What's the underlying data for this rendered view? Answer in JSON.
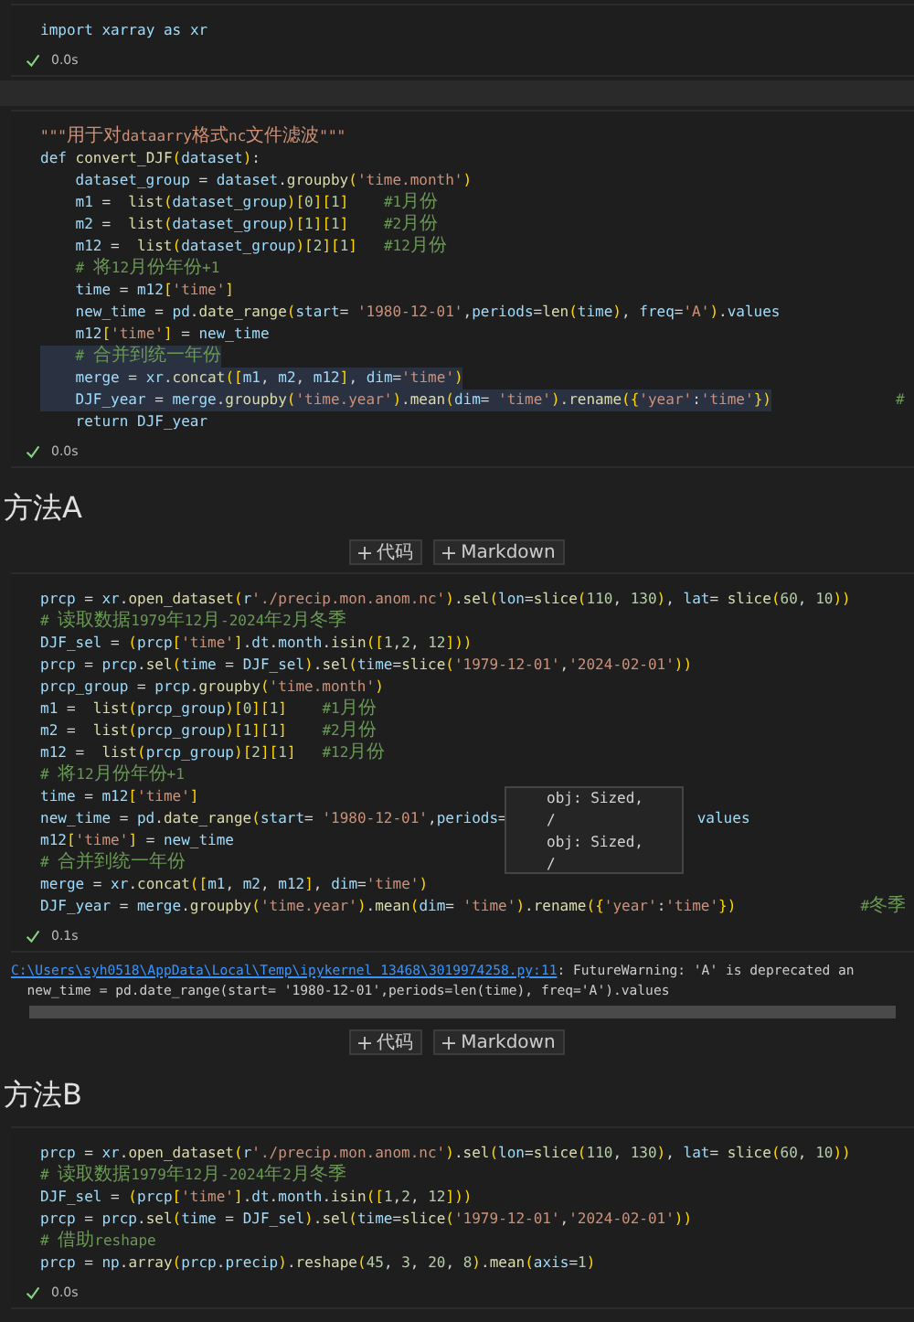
{
  "items": [
    {
      "kind": "code",
      "lines": [
        {
          "text": "import xarray as xr"
        }
      ],
      "status": {
        "time": "0.0s"
      }
    },
    {
      "kind": "gap"
    },
    {
      "kind": "code",
      "lines": [
        {
          "text": "\"\"\"用于对dataarry格式nc文件滤波\"\"\"",
          "selected": false
        },
        {
          "text": "def convert_DJF(dataset):",
          "selected": false
        },
        {
          "text": "    dataset_group = dataset.groupby('time.month')",
          "selected": false
        },
        {
          "text": "    m1 =  list(dataset_group)[0][1]    #1月份",
          "selected": false
        },
        {
          "text": "    m2 =  list(dataset_group)[1][1]    #2月份",
          "selected": false
        },
        {
          "text": "    m12 =  list(dataset_group)[2][1]   #12月份",
          "selected": false
        },
        {
          "text": "    # 将12月份年份+1",
          "selected": false
        },
        {
          "text": "    time = m12['time']",
          "selected": false
        },
        {
          "text": "    new_time = pd.date_range(start= '1980-12-01',periods=len(time), freq='A').values",
          "selected": false
        },
        {
          "text": "    m12['time'] = new_time",
          "selected": false
        },
        {
          "text": "    # 合并到统一年份",
          "selected": true
        },
        {
          "text": "    merge = xr.concat([m1, m2, m12], dim='time')",
          "selected": true
        },
        {
          "text": "    DJF_year = merge.groupby('time.year').mean(dim= 'time').rename({'year':'time'})",
          "comment": "#",
          "selected": true
        },
        {
          "text": "    return DJF_year",
          "selected": false
        }
      ],
      "status": {
        "time": "0.0s"
      }
    },
    {
      "kind": "markdown",
      "heading": "方法A"
    },
    {
      "kind": "toolbar",
      "buttons": [
        "代码",
        "Markdown"
      ]
    },
    {
      "kind": "code",
      "lines": [
        {
          "text": "prcp = xr.open_dataset(r'./precip.mon.anom.nc').sel(lon=slice(110, 130), lat= slice(60, 10))"
        },
        {
          "text": "# 读取数据1979年12月-2024年2月冬季"
        },
        {
          "text": "DJF_sel = (prcp['time'].dt.month.isin([1,2, 12]))"
        },
        {
          "text": "prcp = prcp.sel(time = DJF_sel).sel(time=slice('1979-12-01','2024-02-01'))"
        },
        {
          "text": "prcp_group = prcp.groupby('time.month')"
        },
        {
          "text": "m1 =  list(prcp_group)[0][1]    #1月份"
        },
        {
          "text": "m2 =  list(prcp_group)[1][1]    #2月份"
        },
        {
          "text": "m12 =  list(prcp_group)[2][1]   #12月份"
        },
        {
          "text": "# 将12月份年份+1"
        },
        {
          "text": "time = m12['time']"
        },
        {
          "text": "new_time = pd.date_range(start= '1980-12-01',periods=",
          "tail": "values"
        },
        {
          "text": "m12['time'] = new_time"
        },
        {
          "text": "# 合并到统一年份"
        },
        {
          "text": "merge = xr.concat([m1, m2, m12], dim='time')"
        },
        {
          "text": "DJF_year = merge.groupby('time.year').mean(dim= 'time').rename({'year':'time'})",
          "comment": "#冬季"
        }
      ],
      "hover": {
        "lines": [
          "obj: Sized,",
          "/",
          "obj: Sized,",
          "/"
        ]
      },
      "status": {
        "time": "0.1s"
      }
    },
    {
      "kind": "output",
      "lines": [
        {
          "link": "C:\\Users\\syh0518\\AppData\\Local\\Temp\\ipykernel_13468\\3019974258.py:11",
          "text": ": FutureWarning: 'A' is deprecated an"
        },
        {
          "text": "  new_time = pd.date_range(start= '1980-12-01',periods=len(time), freq='A').values"
        }
      ]
    },
    {
      "kind": "toolbar",
      "buttons": [
        "代码",
        "Markdown"
      ]
    },
    {
      "kind": "markdown",
      "heading": "方法B"
    },
    {
      "kind": "code",
      "lines": [
        {
          "text": "prcp = xr.open_dataset(r'./precip.mon.anom.nc').sel(lon=slice(110, 130), lat= slice(60, 10))"
        },
        {
          "text": "# 读取数据1979年12月-2024年2月冬季"
        },
        {
          "text": "DJF_sel = (prcp['time'].dt.month.isin([1,2, 12]))"
        },
        {
          "text": "prcp = prcp.sel(time = DJF_sel).sel(time=slice('1979-12-01','2024-02-01'))"
        },
        {
          "text": "# 借助reshape"
        },
        {
          "text": "prcp = np.array(prcp.precip).reshape(45, 3, 20, 8).mean(axis=1)"
        }
      ],
      "status": {
        "time": "0.0s"
      }
    }
  ]
}
